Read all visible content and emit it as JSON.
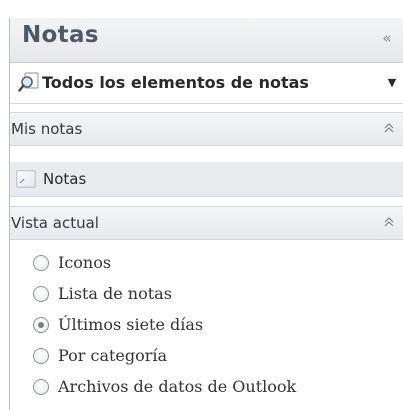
{
  "pane": {
    "title": "Notas",
    "collapse_icon": "double-chevron-left-icon",
    "collapse_glyph": "«"
  },
  "scope": {
    "label": "Todos los elementos de notas",
    "icon": "search-icon",
    "dropdown_glyph": "▼"
  },
  "my_notes": {
    "header": "Mis notas",
    "chevron_glyph": "⌃",
    "folders": [
      {
        "label": "Notas",
        "icon": "note-icon"
      }
    ]
  },
  "current_view": {
    "header": "Vista actual",
    "chevron_glyph": "⌃",
    "options": [
      {
        "label": "Iconos",
        "selected": false
      },
      {
        "label": "Lista de notas",
        "selected": false
      },
      {
        "label": "Últimos siete días",
        "selected": true
      },
      {
        "label": "Por categoría",
        "selected": false
      },
      {
        "label": "Archivos de datos de Outlook",
        "selected": false
      }
    ]
  }
}
